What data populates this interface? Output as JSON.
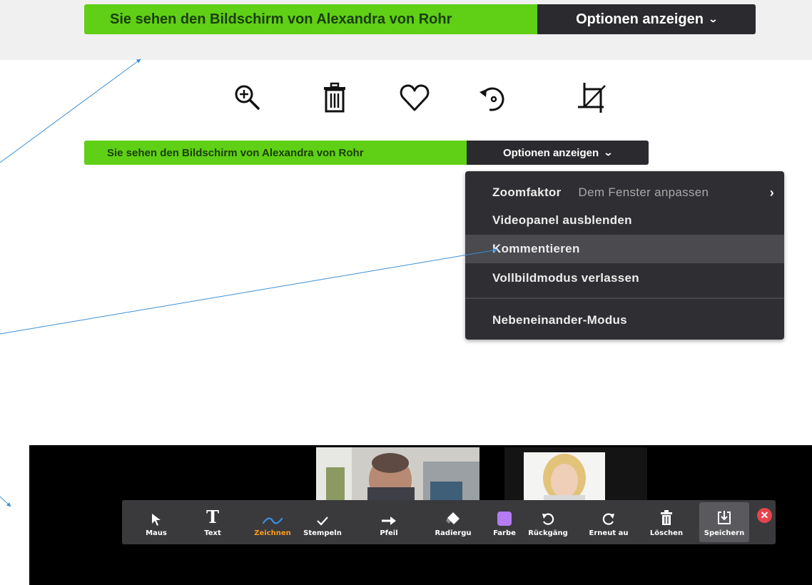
{
  "top_banner": {
    "sharing_text": "Sie sehen den Bildschirm von Alexandra von Rohr",
    "options_label": "Optionen anzeigen"
  },
  "image_toolbar": {
    "icons": [
      "zoom-in-icon",
      "trash-icon",
      "heart-icon",
      "rotate-icon",
      "crop-icon"
    ]
  },
  "second_banner": {
    "sharing_text": "Sie sehen den Bildschirm von Alexandra von Rohr",
    "options_label": "Optionen anzeigen"
  },
  "options_menu": {
    "items": [
      {
        "label": "Zoomfaktor",
        "value": "Dem Fenster anpassen"
      },
      {
        "label": "Videopanel ausblenden"
      },
      {
        "label": "Kommentieren"
      },
      {
        "label": "Vollbildmodus verlassen"
      },
      {
        "label": "Nebeneinander-Modus"
      }
    ]
  },
  "annotation_toolbar": {
    "tools": [
      {
        "label": "Maus",
        "icon": "cursor-icon"
      },
      {
        "label": "Text",
        "icon": "text-icon"
      },
      {
        "label": "Zeichnen",
        "icon": "draw-icon"
      },
      {
        "label": "Stempeln",
        "icon": "stamp-icon"
      },
      {
        "label": "Pfeil",
        "icon": "arrow-icon"
      },
      {
        "label": "Radiergu",
        "icon": "eraser-icon"
      },
      {
        "label": "Farbe",
        "icon": "color-icon"
      },
      {
        "label": "Rückgäng",
        "icon": "undo-icon"
      },
      {
        "label": "Erneut au",
        "icon": "redo-icon"
      },
      {
        "label": "Löschen",
        "icon": "trash-icon"
      },
      {
        "label": "Speichern",
        "icon": "save-icon"
      }
    ],
    "active_tool": "Zeichnen",
    "current_color": "#b57bf5"
  },
  "colors": {
    "banner_green": "#5fd015",
    "banner_dark": "#2b2b2f",
    "menu_bg": "#2f2f33",
    "active_tool_label": "#ff9a1a",
    "draw_icon": "#3a8ee6",
    "close_red": "#e8434b",
    "callout_line": "#3a8fd6"
  }
}
